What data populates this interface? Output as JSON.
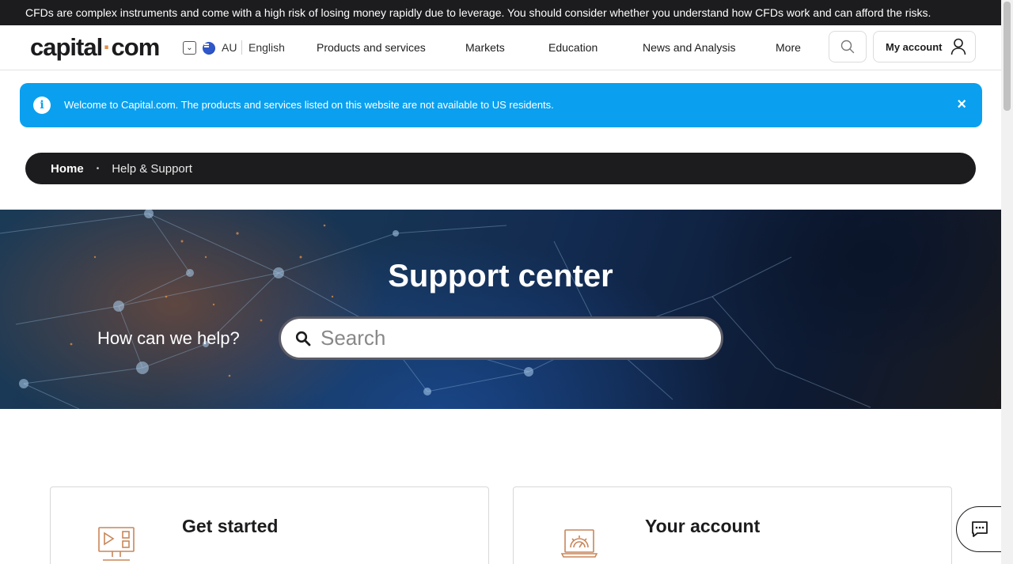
{
  "risk_warning": "CFDs are complex instruments and come with a high risk of losing money rapidly due to leverage. You should consider whether you understand how CFDs work and can afford the risks.",
  "header": {
    "logo_part1": "capital",
    "logo_dot": "·",
    "logo_part2": "com",
    "region": "AU",
    "language": "English",
    "nav": [
      "Products and services",
      "Markets",
      "Education",
      "News and Analysis",
      "More"
    ],
    "account_label": "My account"
  },
  "notice": {
    "message": "Welcome to Capital.com. The products and services listed on this website are not available to US residents.",
    "close": "×"
  },
  "breadcrumb": {
    "home": "Home",
    "separator": "•",
    "current": "Help & Support"
  },
  "hero": {
    "title": "Support center",
    "help_text": "How can we help?",
    "search_placeholder": "Search"
  },
  "cards": [
    {
      "title": "Get started",
      "icon": "monitor-play-icon"
    },
    {
      "title": "Your account",
      "icon": "laptop-gear-icon"
    }
  ],
  "colors": {
    "accent_orange": "#e08e4b",
    "notice_blue": "#0aa0ef",
    "dark": "#1c1c1e"
  }
}
